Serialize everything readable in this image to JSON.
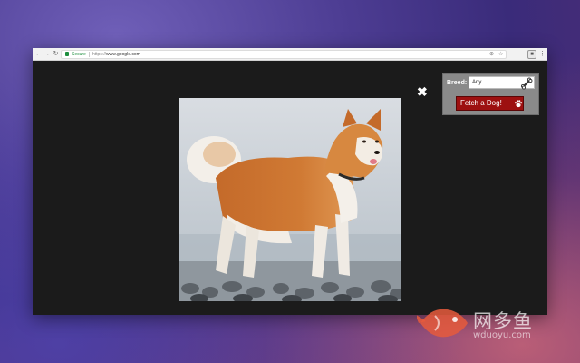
{
  "browser": {
    "secure_label": "Secure",
    "url_scheme": "https://",
    "url_host": "www.google.com"
  },
  "popup": {
    "breed_label": "Breed:",
    "breed_value": "Any",
    "fetch_label": "Fetch a Dog!"
  },
  "overlay": {
    "close_glyph": "✖"
  },
  "icons": {
    "back": "back-arrow-icon",
    "forward": "forward-arrow-icon",
    "reload": "reload-icon",
    "lock": "lock-icon",
    "bone": "bone-icon",
    "paw": "paw-icon",
    "star": "star-icon",
    "extension": "extension-icon",
    "menu": "menu-icon"
  },
  "colors": {
    "fetch_button": "#9d1010",
    "popup_bg": "#8a8a8a",
    "secure_green": "#1e8e3e"
  },
  "watermark": {
    "title": "网多鱼",
    "subtitle": "wduoyu.com"
  }
}
